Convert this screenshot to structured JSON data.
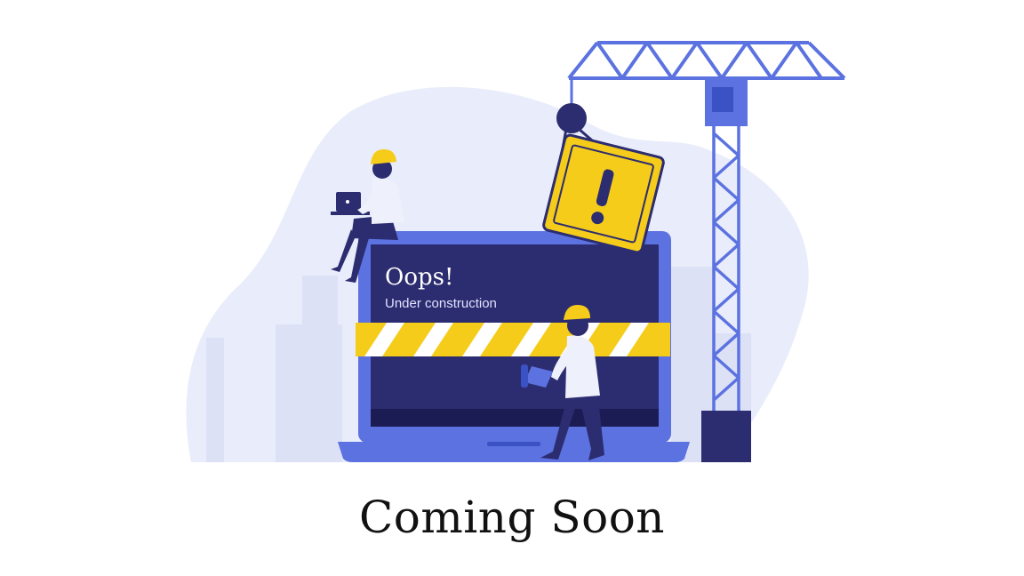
{
  "illustration": {
    "screen_title": "Oops!",
    "screen_subtitle": "Under construction",
    "sign_symbol": "!"
  },
  "headline": "Coming Soon",
  "colors": {
    "background_blob": "#e9ecfa",
    "laptop_frame": "#5b72e0",
    "laptop_screen": "#2c2c70",
    "caution_yellow": "#f5cc1a",
    "crane_blue": "#5b72e0",
    "crane_dark": "#2c2c70",
    "headline": "#111111"
  },
  "icons": [
    "warning-sign-icon",
    "crane-icon",
    "megaphone-icon",
    "laptop-icon",
    "hard-hat-icon"
  ]
}
